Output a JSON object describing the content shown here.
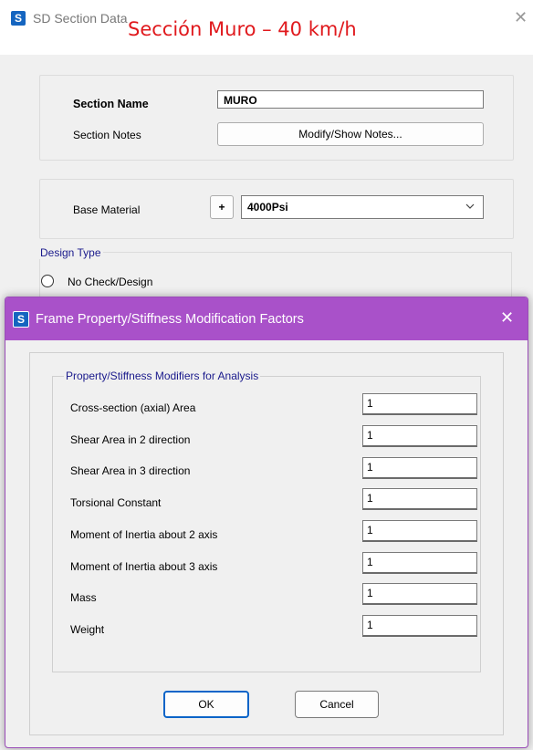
{
  "background_window": {
    "app_icon_letter": "S",
    "title": "SD Section Data",
    "annotation": "Sección Muro – 40 km/h",
    "section_name_label": "Section Name",
    "section_name_value": "MURO",
    "section_notes_label": "Section Notes",
    "modify_notes_button": "Modify/Show Notes...",
    "base_material_label": "Base Material",
    "add_material_button": "+",
    "base_material_value": "4000Psi",
    "design_type_legend": "Design Type",
    "no_check_option": "No Check/Design"
  },
  "modal": {
    "app_icon_letter": "S",
    "title": "Frame Property/Stiffness Modification Factors",
    "group_legend": "Property/Stiffness Modifiers for Analysis",
    "modifiers": [
      {
        "label": "Cross-section (axial) Area",
        "value": "1"
      },
      {
        "label": "Shear Area in 2 direction",
        "value": "1"
      },
      {
        "label": "Shear Area in 3 direction",
        "value": "1"
      },
      {
        "label": "Torsional Constant",
        "value": "1"
      },
      {
        "label": "Moment of Inertia about 2 axis",
        "value": "1"
      },
      {
        "label": "Moment of Inertia about 3 axis",
        "value": "1"
      },
      {
        "label": "Mass",
        "value": "1"
      },
      {
        "label": "Weight",
        "value": "1"
      }
    ],
    "ok_button": "OK",
    "cancel_button": "Cancel"
  },
  "colors": {
    "modal_titlebar": "#a951c9",
    "annotation_red": "#e0191d",
    "app_icon_blue": "#1565c0",
    "legend_blue": "#1a1a8c",
    "ok_border": "#0a64c8"
  },
  "icons": {
    "close": "close-icon",
    "dropdown": "chevron-down-icon",
    "radio": "radio-unchecked-icon"
  }
}
